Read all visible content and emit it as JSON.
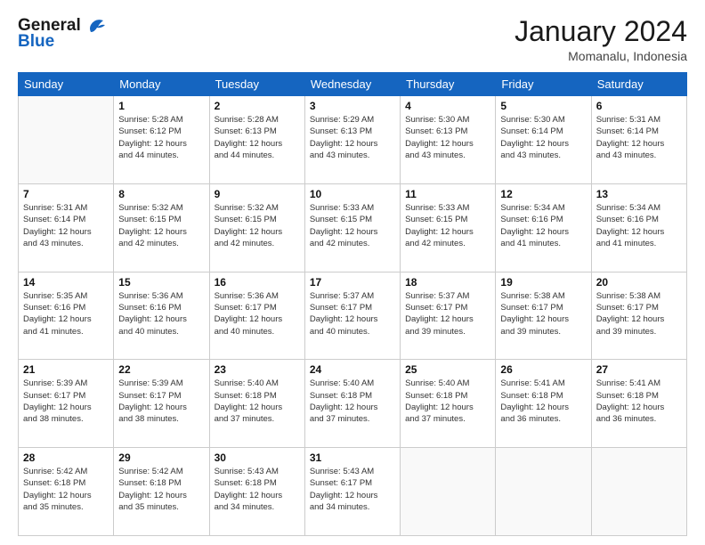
{
  "header": {
    "logo_line1": "General",
    "logo_line2": "Blue",
    "month": "January 2024",
    "location": "Momanalu, Indonesia"
  },
  "days_of_week": [
    "Sunday",
    "Monday",
    "Tuesday",
    "Wednesday",
    "Thursday",
    "Friday",
    "Saturday"
  ],
  "weeks": [
    [
      {
        "day": "",
        "info": ""
      },
      {
        "day": "1",
        "info": "Sunrise: 5:28 AM\nSunset: 6:12 PM\nDaylight: 12 hours\nand 44 minutes."
      },
      {
        "day": "2",
        "info": "Sunrise: 5:28 AM\nSunset: 6:13 PM\nDaylight: 12 hours\nand 44 minutes."
      },
      {
        "day": "3",
        "info": "Sunrise: 5:29 AM\nSunset: 6:13 PM\nDaylight: 12 hours\nand 43 minutes."
      },
      {
        "day": "4",
        "info": "Sunrise: 5:30 AM\nSunset: 6:13 PM\nDaylight: 12 hours\nand 43 minutes."
      },
      {
        "day": "5",
        "info": "Sunrise: 5:30 AM\nSunset: 6:14 PM\nDaylight: 12 hours\nand 43 minutes."
      },
      {
        "day": "6",
        "info": "Sunrise: 5:31 AM\nSunset: 6:14 PM\nDaylight: 12 hours\nand 43 minutes."
      }
    ],
    [
      {
        "day": "7",
        "info": "Sunrise: 5:31 AM\nSunset: 6:14 PM\nDaylight: 12 hours\nand 43 minutes."
      },
      {
        "day": "8",
        "info": "Sunrise: 5:32 AM\nSunset: 6:15 PM\nDaylight: 12 hours\nand 42 minutes."
      },
      {
        "day": "9",
        "info": "Sunrise: 5:32 AM\nSunset: 6:15 PM\nDaylight: 12 hours\nand 42 minutes."
      },
      {
        "day": "10",
        "info": "Sunrise: 5:33 AM\nSunset: 6:15 PM\nDaylight: 12 hours\nand 42 minutes."
      },
      {
        "day": "11",
        "info": "Sunrise: 5:33 AM\nSunset: 6:15 PM\nDaylight: 12 hours\nand 42 minutes."
      },
      {
        "day": "12",
        "info": "Sunrise: 5:34 AM\nSunset: 6:16 PM\nDaylight: 12 hours\nand 41 minutes."
      },
      {
        "day": "13",
        "info": "Sunrise: 5:34 AM\nSunset: 6:16 PM\nDaylight: 12 hours\nand 41 minutes."
      }
    ],
    [
      {
        "day": "14",
        "info": "Sunrise: 5:35 AM\nSunset: 6:16 PM\nDaylight: 12 hours\nand 41 minutes."
      },
      {
        "day": "15",
        "info": "Sunrise: 5:36 AM\nSunset: 6:16 PM\nDaylight: 12 hours\nand 40 minutes."
      },
      {
        "day": "16",
        "info": "Sunrise: 5:36 AM\nSunset: 6:17 PM\nDaylight: 12 hours\nand 40 minutes."
      },
      {
        "day": "17",
        "info": "Sunrise: 5:37 AM\nSunset: 6:17 PM\nDaylight: 12 hours\nand 40 minutes."
      },
      {
        "day": "18",
        "info": "Sunrise: 5:37 AM\nSunset: 6:17 PM\nDaylight: 12 hours\nand 39 minutes."
      },
      {
        "day": "19",
        "info": "Sunrise: 5:38 AM\nSunset: 6:17 PM\nDaylight: 12 hours\nand 39 minutes."
      },
      {
        "day": "20",
        "info": "Sunrise: 5:38 AM\nSunset: 6:17 PM\nDaylight: 12 hours\nand 39 minutes."
      }
    ],
    [
      {
        "day": "21",
        "info": "Sunrise: 5:39 AM\nSunset: 6:17 PM\nDaylight: 12 hours\nand 38 minutes."
      },
      {
        "day": "22",
        "info": "Sunrise: 5:39 AM\nSunset: 6:17 PM\nDaylight: 12 hours\nand 38 minutes."
      },
      {
        "day": "23",
        "info": "Sunrise: 5:40 AM\nSunset: 6:18 PM\nDaylight: 12 hours\nand 37 minutes."
      },
      {
        "day": "24",
        "info": "Sunrise: 5:40 AM\nSunset: 6:18 PM\nDaylight: 12 hours\nand 37 minutes."
      },
      {
        "day": "25",
        "info": "Sunrise: 5:40 AM\nSunset: 6:18 PM\nDaylight: 12 hours\nand 37 minutes."
      },
      {
        "day": "26",
        "info": "Sunrise: 5:41 AM\nSunset: 6:18 PM\nDaylight: 12 hours\nand 36 minutes."
      },
      {
        "day": "27",
        "info": "Sunrise: 5:41 AM\nSunset: 6:18 PM\nDaylight: 12 hours\nand 36 minutes."
      }
    ],
    [
      {
        "day": "28",
        "info": "Sunrise: 5:42 AM\nSunset: 6:18 PM\nDaylight: 12 hours\nand 35 minutes."
      },
      {
        "day": "29",
        "info": "Sunrise: 5:42 AM\nSunset: 6:18 PM\nDaylight: 12 hours\nand 35 minutes."
      },
      {
        "day": "30",
        "info": "Sunrise: 5:43 AM\nSunset: 6:18 PM\nDaylight: 12 hours\nand 34 minutes."
      },
      {
        "day": "31",
        "info": "Sunrise: 5:43 AM\nSunset: 6:17 PM\nDaylight: 12 hours\nand 34 minutes."
      },
      {
        "day": "",
        "info": ""
      },
      {
        "day": "",
        "info": ""
      },
      {
        "day": "",
        "info": ""
      }
    ]
  ]
}
